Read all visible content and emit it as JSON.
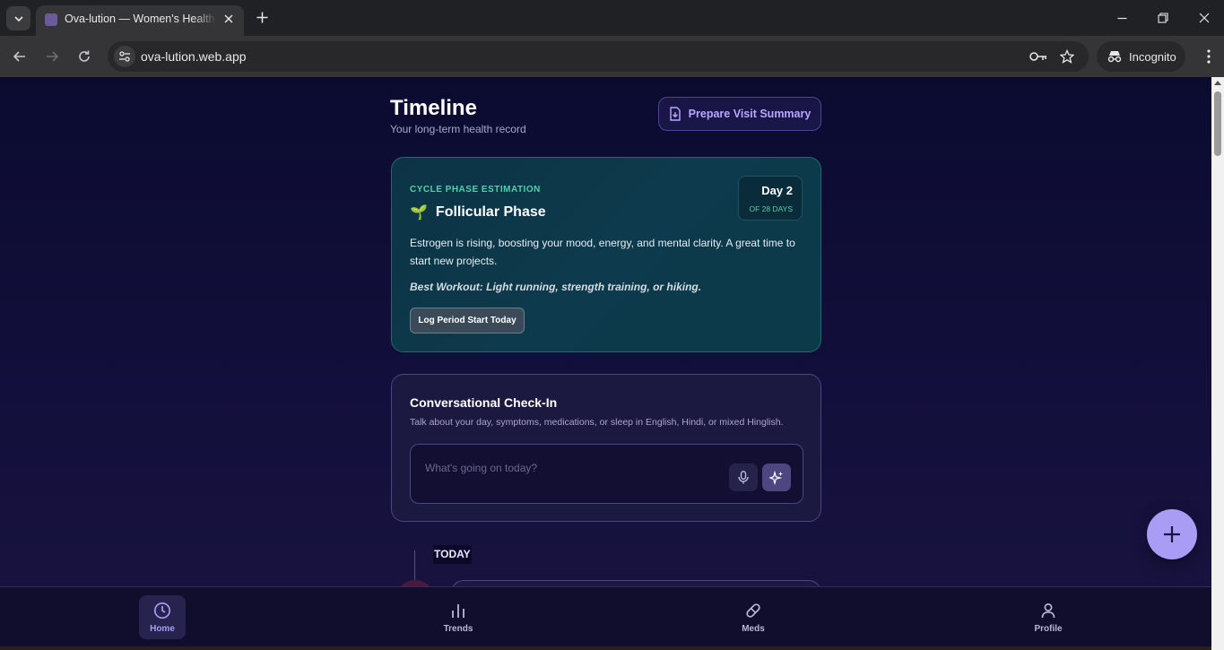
{
  "browser": {
    "tab_title": "Ova-lution — Women's Health",
    "url": "ova-lution.web.app",
    "incognito_label": "Incognito"
  },
  "page": {
    "title": "Timeline",
    "subtitle": "Your long-term health record",
    "prepare_label": "Prepare Visit Summary"
  },
  "cycle": {
    "kicker": "CYCLE PHASE ESTIMATION",
    "phase_emoji": "🌱",
    "phase": "Follicular Phase",
    "day_label": "Day 2",
    "day_of": "OF 28 DAYS",
    "description": "Estrogen is rising, boosting your mood, energy, and mental clarity. A great time to start new projects.",
    "workout": "Best Workout: Light running, strength training, or hiking.",
    "log_button": "Log Period Start Today"
  },
  "checkin": {
    "title": "Conversational Check-In",
    "subtitle": "Talk about your day, symptoms, medications, or sleep in English, Hindi, or mixed Hinglish.",
    "placeholder": "What's going on today?"
  },
  "timeline": {
    "today_label": "TODAY"
  },
  "nav": {
    "items": [
      {
        "label": "Home",
        "icon": "clock-icon",
        "active": true
      },
      {
        "label": "Trends",
        "icon": "bar-chart-icon",
        "active": false
      },
      {
        "label": "Meds",
        "icon": "pill-icon",
        "active": false
      },
      {
        "label": "Profile",
        "icon": "user-icon",
        "active": false
      }
    ]
  },
  "colors": {
    "accent": "#a99cf5",
    "teal_accent": "#4fd1a9",
    "background": "#0b0b30"
  }
}
